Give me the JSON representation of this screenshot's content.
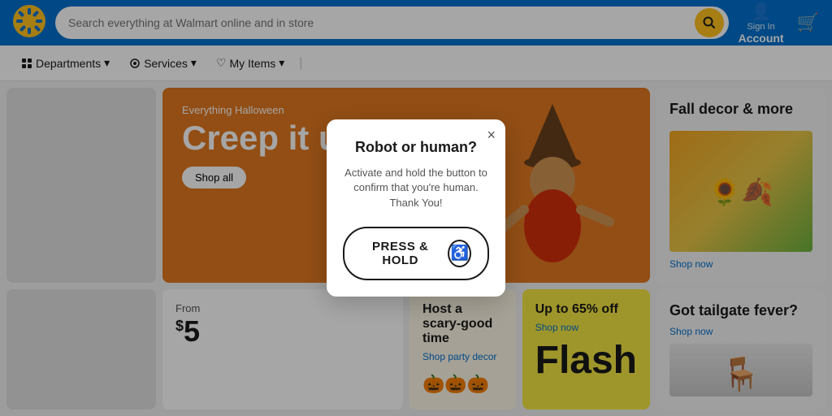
{
  "header": {
    "logo_alt": "Walmart",
    "search_placeholder": "Search everything at Walmart online and in store",
    "search_icon": "🔍",
    "account_sign_in": "Sign In",
    "account_label": "Account",
    "cart_icon": "🛒"
  },
  "subnav": {
    "departments_label": "Departments",
    "services_label": "Services",
    "my_items_label": "My Items"
  },
  "banner": {
    "tag": "Everything Halloween",
    "title": "Creep it up",
    "shop_all_label": "Shop all"
  },
  "fall_decor": {
    "title": "Fall decor & more",
    "shop_now": "Shop now"
  },
  "from_price": {
    "from_label": "From",
    "dollar": "$",
    "amount": "5"
  },
  "host_card": {
    "title": "Host a scary-good time",
    "link": "Shop party decor"
  },
  "flash_card": {
    "title": "Up to 65% off",
    "link": "Shop now",
    "flash_text": "Flash"
  },
  "tailgate_card": {
    "title": "Got tailgate fever?",
    "link": "Shop now"
  },
  "modal": {
    "title": "Robot or human?",
    "description": "Activate and hold the button to confirm that you're human. Thank You!",
    "button_label": "PRESS & HOLD",
    "close_icon": "×"
  }
}
